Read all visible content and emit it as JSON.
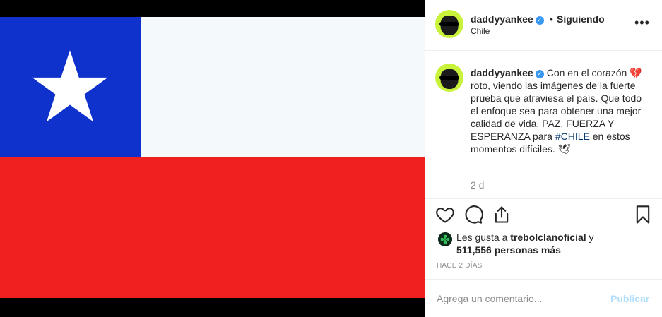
{
  "post": {
    "author": "daddyyankee",
    "follow_status": "Siguiendo",
    "separator": "•",
    "location": "Chile",
    "more_label": "•••"
  },
  "caption": {
    "author": "daddyyankee",
    "text_part1": "Con en el corazón 💔 roto, viendo las imágenes de la fuerte prueba que atraviesa el país. Que todo el enfoque sea para obtener una mejor calidad de vida. PAZ, FUERZA Y ESPERANZA para ",
    "hashtag": "#CHILE",
    "text_part2": " en estos momentos difíciles. 🕊",
    "time": "2 d"
  },
  "likes": {
    "prefix": "Les gusta a ",
    "liked_by": "trebolclanoficial",
    "connector": " y",
    "others": "511,556 personas más"
  },
  "timestamp": "HACE 2 DÍAS",
  "comment": {
    "placeholder": "Agrega un comentario...",
    "publish_label": "Publicar"
  },
  "icons": {
    "like": "heart-icon",
    "comment": "comment-icon",
    "share": "share-icon",
    "save": "bookmark-icon",
    "verified": "verified-badge-icon"
  },
  "colors": {
    "flag_blue": "#0f31cc",
    "flag_red": "#ef2020",
    "flag_white": "#f4fafc",
    "verified_blue": "#3897f0",
    "hashtag_blue": "#003569",
    "publish_disabled": "#b2dffc",
    "avatar_green": "#c9f23a"
  }
}
